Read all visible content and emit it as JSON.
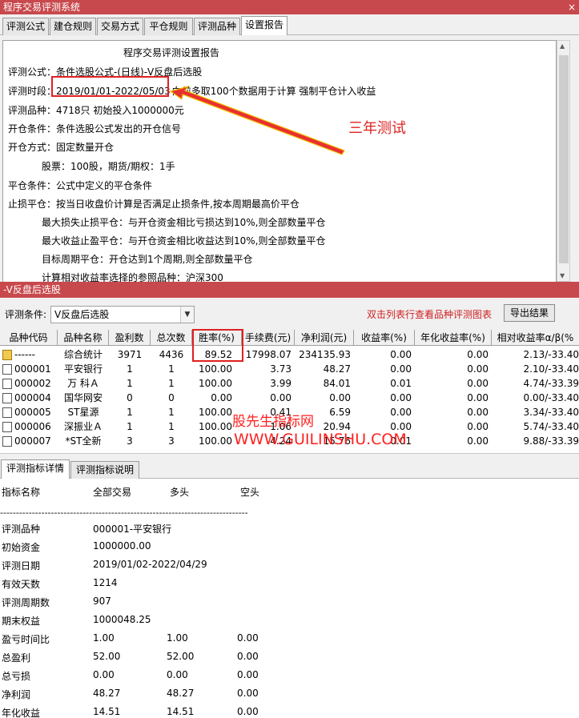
{
  "window": {
    "title": "程序交易评测系统",
    "ctl": "×"
  },
  "top_tabs": [
    "评测公式",
    "建仓规则",
    "交易方式",
    "平仓规则",
    "评测品种",
    "设置报告"
  ],
  "report": {
    "heading": "程序交易评测设置报告",
    "formula": "评测公式：条件选股公式-(日线)-V反盘后选股",
    "period_label": "评测时段：",
    "period_value": "2019/01/01-2022/05/03",
    "period_rest": "向前多取100个数据用于计算 强制平仓计入收益",
    "products": "评测品种：4718只 初始投入1000000元",
    "open_cond": "开仓条件：条件选股公式发出的开仓信号",
    "open_mode": "开仓方式：固定数量开仓",
    "open_qty": "股票：100股，期货/期权：1手",
    "close_cond": "平仓条件：公式中定义的平仓条件",
    "stop_loss": "止损平仓：按当日收盘价计算是否满足止损条件,按本周期最高价平仓",
    "max_loss": "最大损失止损平仓：与开仓资金相比亏损达到10%,则全部数量平仓",
    "max_gain": "最大收益止盈平仓：与开仓资金相比收益达到10%,则全部数量平仓",
    "target_period": "目标周期平仓：开仓达到1个周期,则全部数量平仓",
    "ref_product": "计算相对收益率选择的参照品种：沪深300"
  },
  "annotation": {
    "label": "三年测试",
    "color": "#e02020"
  },
  "section2_title": "-V反盘后选股",
  "cond": {
    "label": "评测条件:",
    "selected": "V反盘后选股",
    "hint": "双击列表行查看品种评测图表",
    "export_label": "导出结果"
  },
  "grid": {
    "headers": [
      "品种代码",
      "品种名称",
      "盈利数",
      "总次数",
      "胜率(%)",
      "手续费(元)",
      "净利润(元)",
      "收益率(%)",
      "年化收益率(%)",
      "相对收益率α/β(%"
    ],
    "rows": [
      [
        "------",
        "综合统计",
        "3971",
        "4436",
        "89.52",
        "17998.07",
        "234135.93",
        "0.00",
        "0.00",
        "2.13/-33.40"
      ],
      [
        "000001",
        "平安银行",
        "1",
        "1",
        "100.00",
        "3.73",
        "48.27",
        "0.00",
        "0.00",
        "2.10/-33.40"
      ],
      [
        "000002",
        "万 科Ａ",
        "1",
        "1",
        "100.00",
        "3.99",
        "84.01",
        "0.01",
        "0.00",
        "4.74/-33.39"
      ],
      [
        "000004",
        "国华网安",
        "0",
        "0",
        "0.00",
        "0.00",
        "0.00",
        "0.00",
        "0.00",
        "0.00/-33.40"
      ],
      [
        "000005",
        "ST星源",
        "1",
        "1",
        "100.00",
        "0.41",
        "6.59",
        "0.00",
        "0.00",
        "3.34/-33.40"
      ],
      [
        "000006",
        "深振业Ａ",
        "1",
        "1",
        "100.00",
        "1.06",
        "20.94",
        "0.00",
        "0.00",
        "5.74/-33.40"
      ],
      [
        "000007",
        "*ST全新",
        "3",
        "3",
        "100.00",
        "4.24",
        "15.76",
        "0.01",
        "0.00",
        "9.88/-33.39"
      ]
    ]
  },
  "watermark": {
    "line1": "股先生指标网",
    "line2": "WWW.GUILINSHU.COM"
  },
  "bottom_tabs": [
    "评测指标详情",
    "评测指标说明"
  ],
  "detail": {
    "headers": [
      "指标名称",
      "全部交易",
      "多头",
      "空头"
    ],
    "dashes": "------------------------------------------------------------------------------",
    "rows": [
      {
        "name": "评测品种",
        "all": "000001-平安银行",
        "long": "",
        "short": ""
      },
      {
        "name": "初始资金",
        "all": "1000000.00",
        "long": "",
        "short": ""
      },
      {
        "name": "评测日期",
        "all": "2019/01/02-2022/04/29",
        "long": "",
        "short": ""
      },
      {
        "name": "有效天数",
        "all": "1214",
        "long": "",
        "short": ""
      },
      {
        "name": "评测周期数",
        "all": "907",
        "long": "",
        "short": ""
      },
      {
        "name": "期末权益",
        "all": "1000048.25",
        "long": "",
        "short": ""
      },
      {
        "name": "盈亏时间比",
        "all": "1.00",
        "long": "1.00",
        "short": "0.00"
      },
      {
        "name": "总盈利",
        "all": "52.00",
        "long": "52.00",
        "short": "0.00"
      },
      {
        "name": "总亏损",
        "all": "0.00",
        "long": "0.00",
        "short": "0.00"
      },
      {
        "name": "净利润",
        "all": "48.27",
        "long": "48.27",
        "short": "0.00"
      },
      {
        "name": "年化收益",
        "all": "14.51",
        "long": "14.51",
        "short": "0.00"
      }
    ]
  }
}
